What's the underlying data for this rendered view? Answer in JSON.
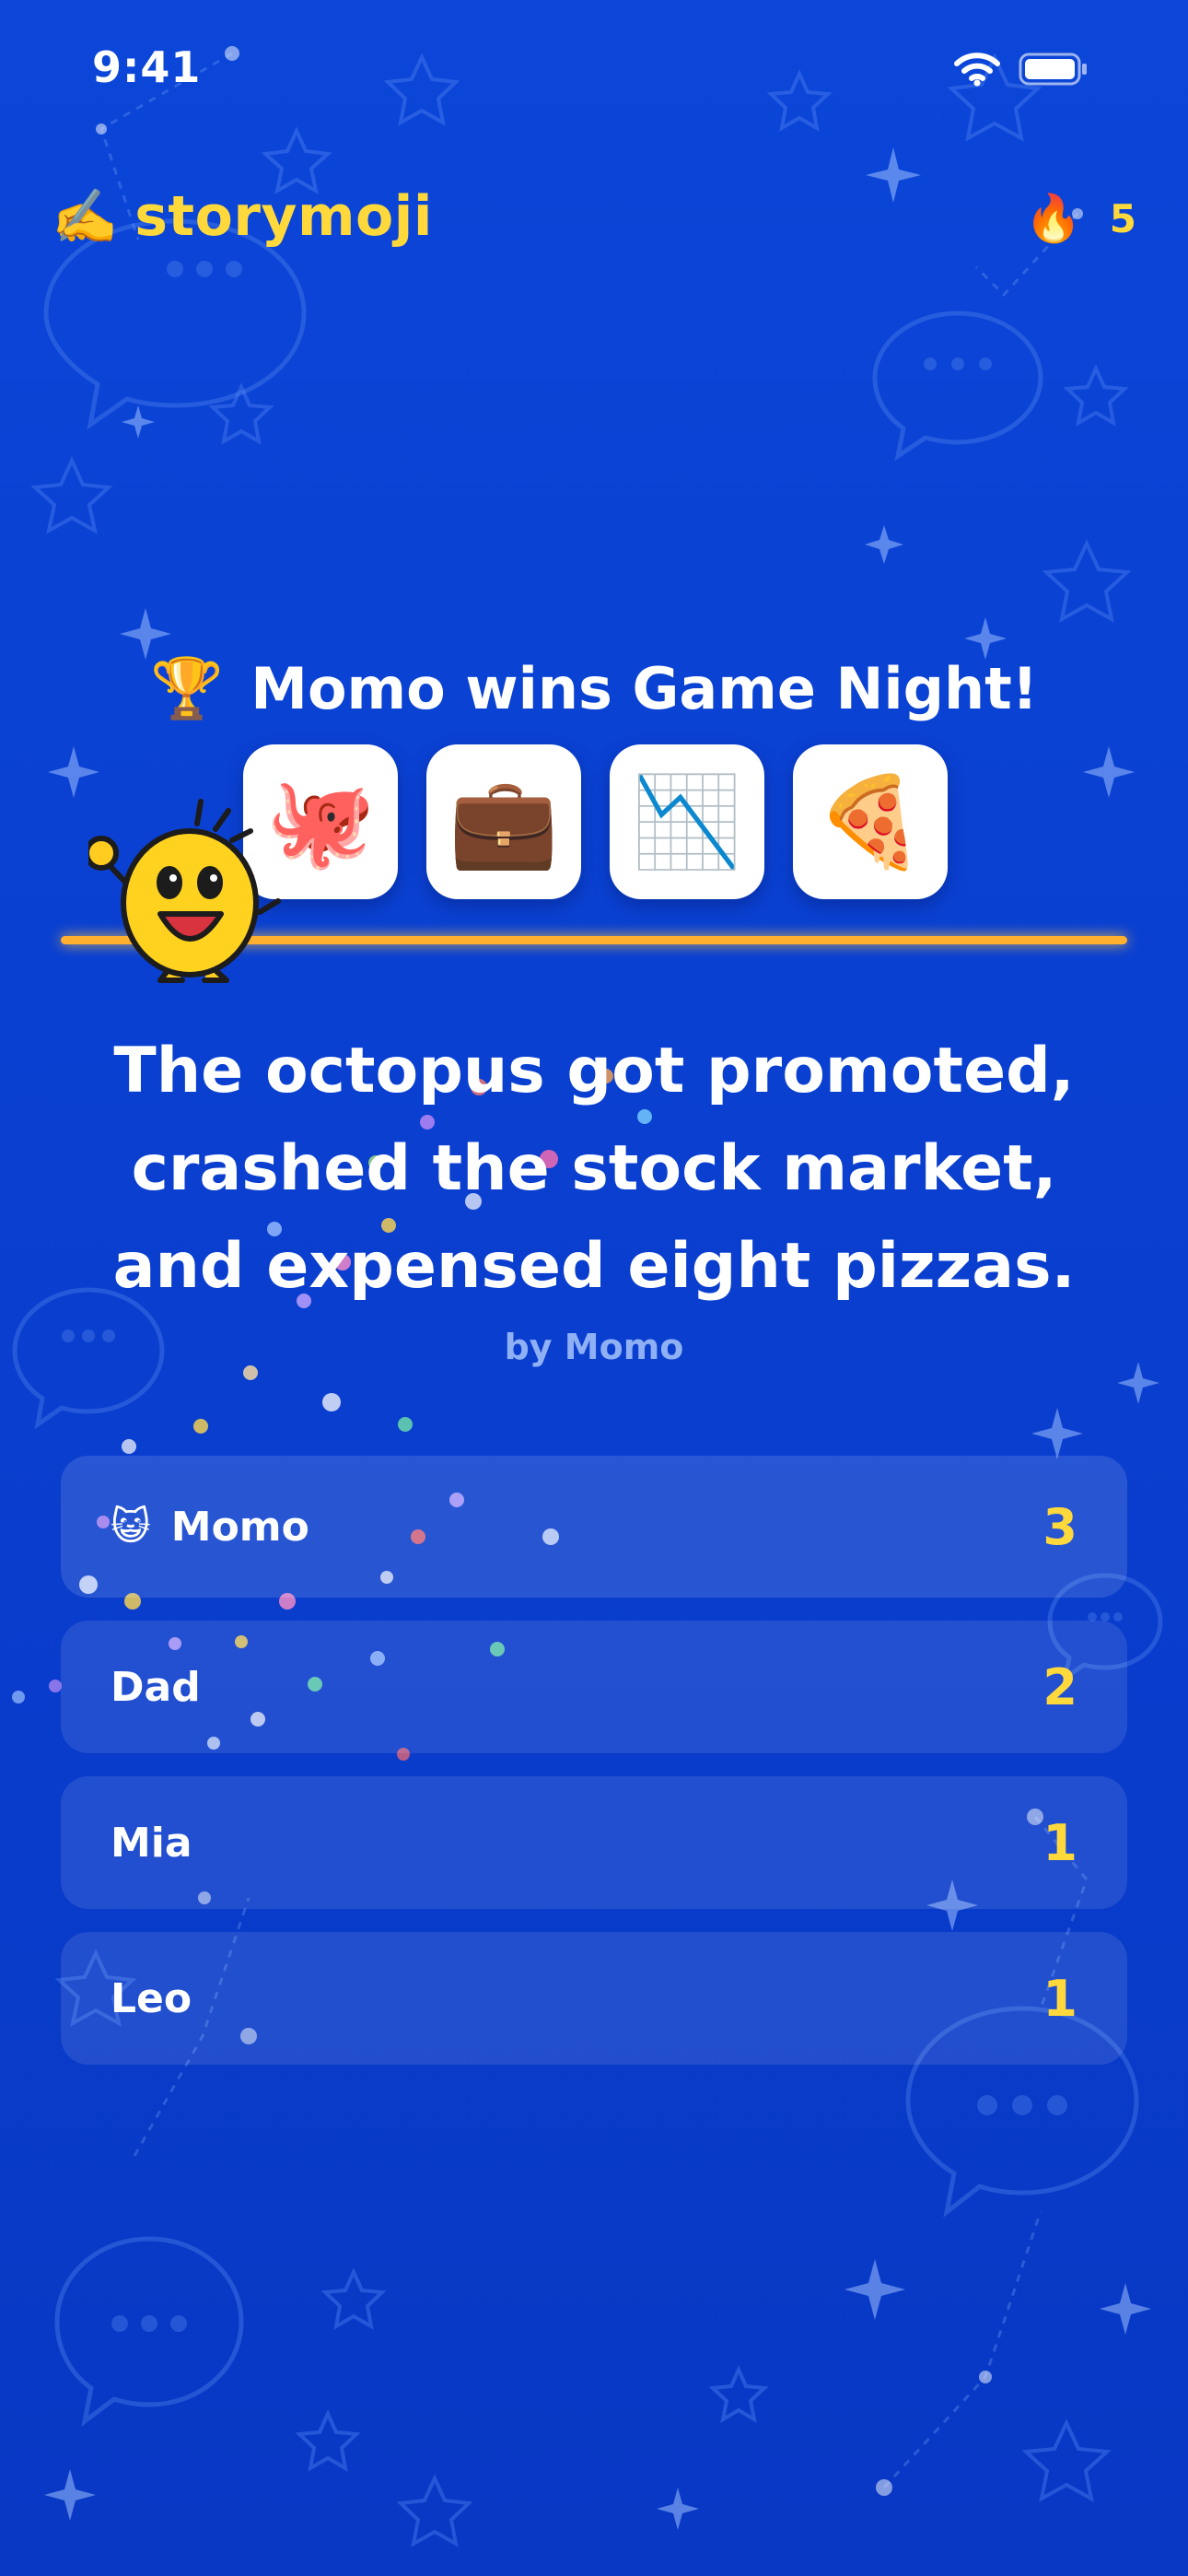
{
  "status_bar": {
    "time": "9:41"
  },
  "app": {
    "brand_icon": "✍️",
    "name": "storymoji",
    "streak_icon": "🔥",
    "streak_count": "5"
  },
  "result": {
    "trophy": "🏆",
    "title": "Momo wins Game Night!",
    "emojis": [
      "🐙",
      "💼",
      "📉",
      "🍕"
    ],
    "story": "The octopus got promoted, crashed the stock market, and expensed eight pizzas.",
    "author": "by Momo"
  },
  "scoreboard": [
    {
      "icon": "😺",
      "name": "Momo",
      "score": "3"
    },
    {
      "icon": "",
      "name": "Dad",
      "score": "2"
    },
    {
      "icon": "",
      "name": "Mia",
      "score": "1"
    },
    {
      "icon": "",
      "name": "Leo",
      "score": "1"
    }
  ],
  "colors": {
    "background": "#0a3fd0",
    "accent_yellow": "#ffd93b",
    "progress_orange": "#ffb02e",
    "muted_text": "#8fb0f5"
  },
  "icons": {
    "wifi": "wifi-icon",
    "battery": "battery-icon",
    "mascot": "cheering-mascot-icon",
    "confetti": "confetti-decoration"
  }
}
